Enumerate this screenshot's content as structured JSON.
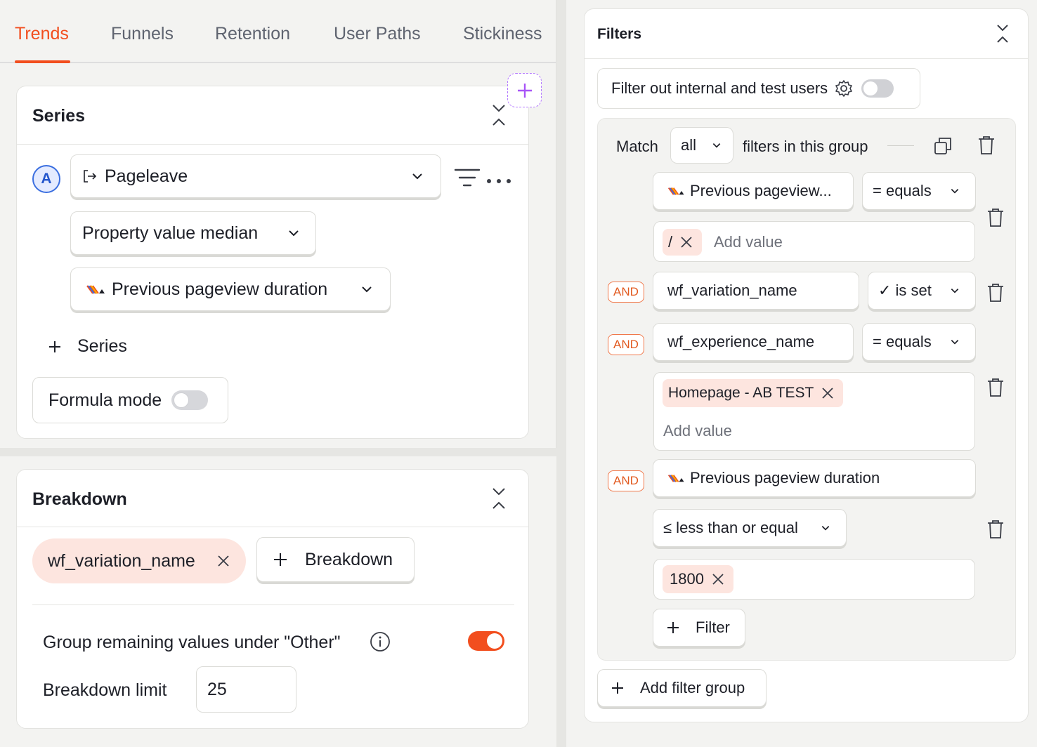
{
  "tabs": [
    "Trends",
    "Funnels",
    "Retention",
    "User Paths",
    "Stickiness"
  ],
  "series": {
    "title": "Series",
    "badge": "A",
    "event": "Pageleave",
    "aggregation": "Property value median",
    "property": "Previous pageview duration",
    "add_label": "Series",
    "formula_label": "Formula mode"
  },
  "breakdown": {
    "title": "Breakdown",
    "chip": "wf_variation_name",
    "add_label": "Breakdown",
    "group_label": "Group remaining values under \"Other\"",
    "limit_label": "Breakdown limit",
    "limit_value": "25"
  },
  "filters": {
    "title": "Filters",
    "internal_label": "Filter out internal and test users",
    "match_label": "Match",
    "match_value": "all",
    "group_label": "filters in this group",
    "and_label": "AND",
    "rows": [
      {
        "property": "Previous pageview...",
        "operator": "= equals",
        "value_chip": "/",
        "add_value": "Add value"
      },
      {
        "property": "wf_variation_name",
        "operator": "✓ is set"
      },
      {
        "property": "wf_experience_name",
        "operator": "= equals",
        "value_chip": "Homepage - AB TEST",
        "add_value": "Add value"
      },
      {
        "property": "Previous pageview duration",
        "operator": "≤ less than or equal",
        "value_chip": "1800"
      }
    ],
    "add_filter": "Filter",
    "add_group": "Add filter group"
  },
  "colors": {
    "accent": "#f24e1e",
    "purple": "#a855f7",
    "blue": "#3b6fe0"
  }
}
